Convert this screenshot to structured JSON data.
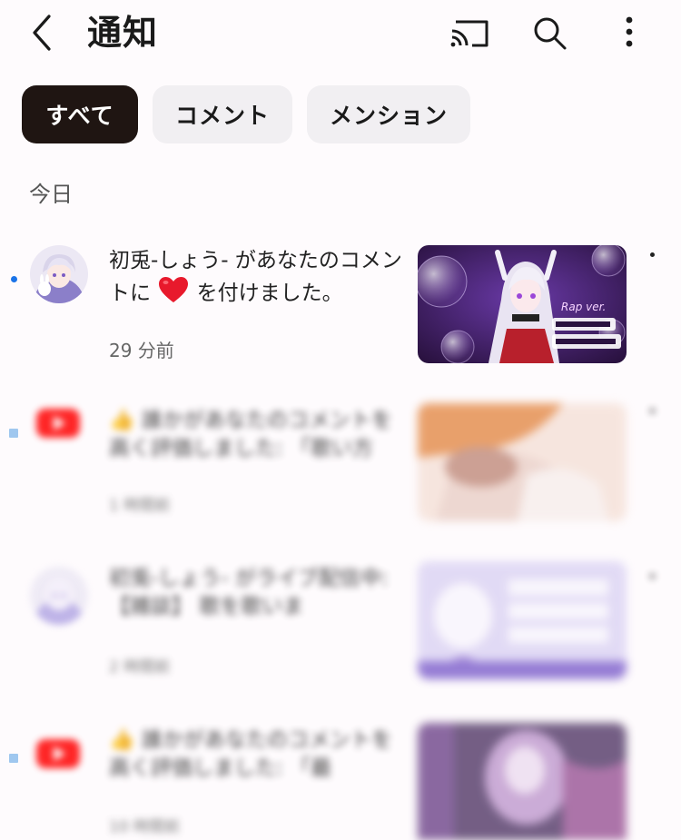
{
  "header": {
    "title": "通知",
    "back_icon": "chevron-left-icon",
    "cast_icon": "cast-icon",
    "search_icon": "search-icon",
    "more_icon": "more-vert-icon"
  },
  "filters": {
    "all": "すべて",
    "comments": "コメント",
    "mentions": "メンション",
    "selected": "すべて"
  },
  "section": {
    "label": "今日"
  },
  "notifications": [
    {
      "message_prefix": "初兎-しょう- があなたのコメントに",
      "message_suffix": "を付けました。",
      "heart_icon": "heart-icon",
      "time": "29 分前",
      "unread": true,
      "thumbnail_text": "Rap ver."
    },
    {
      "message": "👍 誰かがあなたのコメントを高く評価しました: 「歌い方",
      "time": "1 時間前",
      "unread": true,
      "blurred": true
    },
    {
      "message": "初兎-しょう- がライブ配信中: 【雑談】 歌を歌いま",
      "time": "2 時間前",
      "unread": false,
      "blurred": true
    },
    {
      "message": "👍 誰かがあなたのコメントを高く評価しました: 「最",
      "time": "10 時間前",
      "unread": true,
      "blurred": true
    }
  ],
  "colors": {
    "accent_dot": "#1a73e8",
    "chip_active_bg": "#1f1512",
    "youtube_red": "#ff0000",
    "heart_red": "#e8192c"
  }
}
